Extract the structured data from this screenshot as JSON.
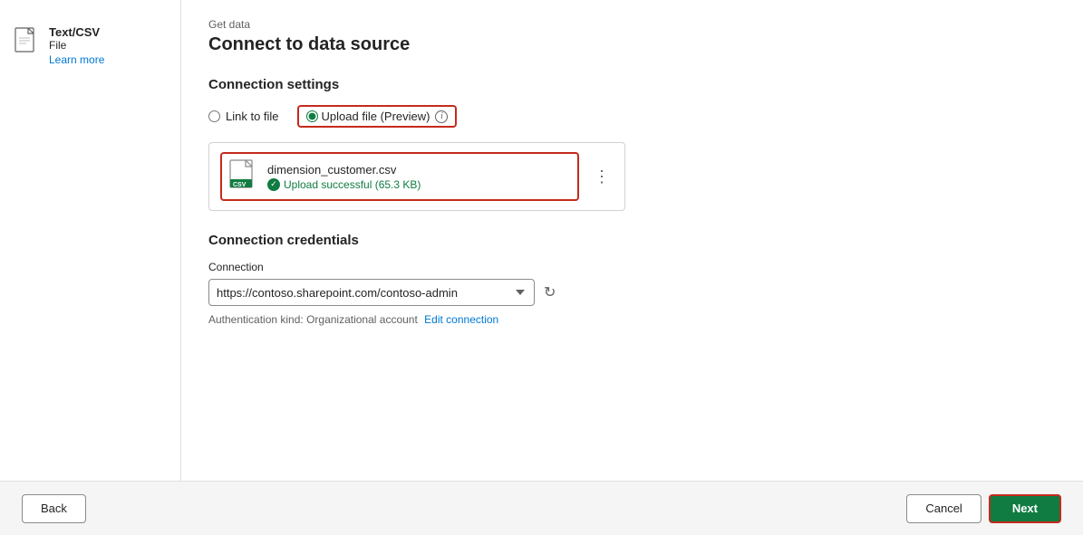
{
  "page": {
    "label": "Get data",
    "title": "Connect to data source"
  },
  "sidebar": {
    "file_type": "Text/CSV",
    "file_label": "File",
    "learn_more": "Learn more"
  },
  "connection_settings": {
    "section_title": "Connection settings",
    "link_to_file_label": "Link to file",
    "upload_file_label": "Upload file (Preview)",
    "info_icon": "i",
    "file": {
      "name": "dimension_customer.csv",
      "status": "Upload successful (65.3 KB)"
    },
    "three_dots": "⋮"
  },
  "connection_credentials": {
    "section_title": "Connection credentials",
    "connection_label": "Connection",
    "connection_value": "https://contoso.sharepoint.com/contoso-admin",
    "auth_text": "Authentication kind: Organizational account",
    "edit_connection": "Edit connection"
  },
  "footer": {
    "back_label": "Back",
    "cancel_label": "Cancel",
    "next_label": "Next"
  }
}
